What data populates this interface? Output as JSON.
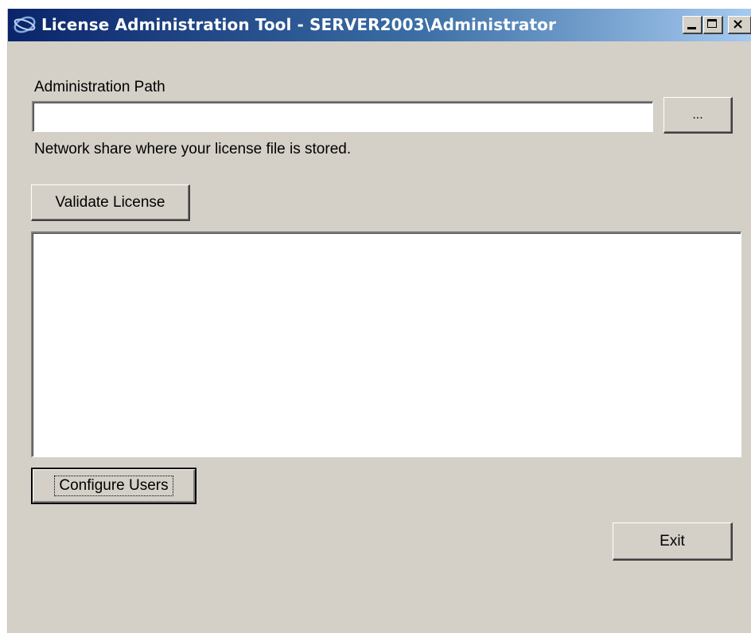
{
  "window": {
    "title": "License Administration Tool - SERVER2003\\Administrator",
    "controls": {
      "minimize": "minimize",
      "maximize": "maximize",
      "close": "×"
    }
  },
  "admin_path": {
    "label": "Administration Path",
    "value": "",
    "browse_label": "...",
    "hint": "Network share where your license file is stored."
  },
  "buttons": {
    "validate": "Validate License",
    "configure_users": "Configure Users",
    "exit": "Exit"
  },
  "results": {
    "lines": []
  },
  "colors": {
    "face": "#d4d0c8",
    "titlebar_start": "#0a246a",
    "titlebar_end": "#a6caf0"
  }
}
